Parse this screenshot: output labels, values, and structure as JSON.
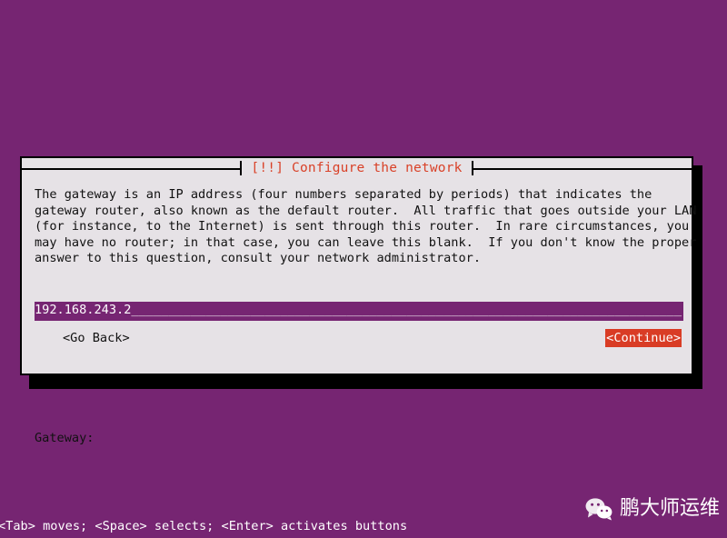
{
  "screen": {
    "background_color": "#762572"
  },
  "dialog": {
    "title": "[!!] Configure the network",
    "title_color": "#d94128",
    "background_color": "#e6e2e6",
    "border_color": "#000000",
    "body_text": "The gateway is an IP address (four numbers separated by periods) that indicates the\ngateway router, also known as the default router.  All traffic that goes outside your LAN\n(for instance, to the Internet) is sent through this router.  In rare circumstances, you\nmay have no router; in that case, you can leave this blank.  If you don't know the proper\nanswer to this question, consult your network administrator.",
    "field": {
      "label": "Gateway:",
      "value": "192.168.243.2",
      "placeholder": "",
      "fill_character": "_",
      "field_background_color": "#762572",
      "field_text_color": "#ffffff"
    },
    "buttons": {
      "go_back": "<Go Back>",
      "continue": "<Continue>",
      "continue_selected": true,
      "continue_highlight_color": "#d93c25"
    }
  },
  "footer": {
    "hint": "<Tab> moves; <Space> selects; <Enter> activates buttons"
  },
  "watermark": {
    "icon": "wechat-icon",
    "text": "鹏大师运维"
  }
}
